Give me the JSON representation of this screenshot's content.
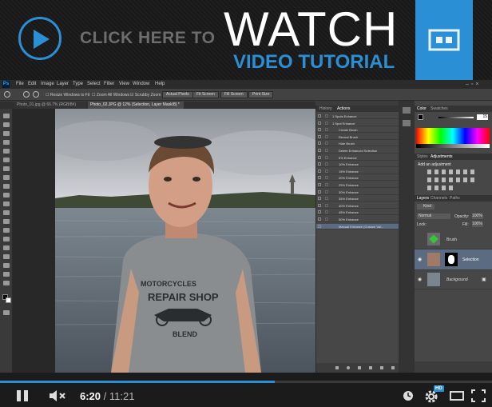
{
  "banner": {
    "cta_text": "CLICK HERE TO",
    "watch_text": "WATCH",
    "subtitle_text": "VIDEO TUTORIAL",
    "accent_color": "#2b8fd6",
    "icon": "play-icon"
  },
  "photoshop": {
    "logo": "Ps",
    "menus": [
      "File",
      "Edit",
      "Image",
      "Layer",
      "Type",
      "Select",
      "Filter",
      "View",
      "Window",
      "Help"
    ],
    "options": {
      "resize_windows": "Resize Windows to Fit",
      "zoom_all": "Zoom All Windows",
      "scrubby_zoom": "Scrubby Zoom",
      "actual_pixels": "Actual Pixels",
      "fit_screen": "Fit Screen",
      "fill_screen": "Fill Screen",
      "print_size": "Print Size"
    },
    "doc_tabs": [
      "Photo_01.jpg @ 66.7% (RGB/8#)",
      "Photo_02.JPG @ 12% (Selection, Layer Mask/8) *"
    ],
    "actions_panel": {
      "tabs": [
        "History",
        "Actions"
      ],
      "rows": [
        "1 Spots Enhance",
        "1 Spot Enhance",
        "Create Brush",
        "Reveal Brush",
        "Hide Brush",
        "Delete Enhanced Selection",
        "5% Enhance",
        "10% Enhance",
        "15% Enhance",
        "20% Enhance",
        "25% Enhance",
        "30% Enhance",
        "35% Enhance",
        "40% Enhance",
        "45% Enhance",
        "50% Enhance",
        "Manual Enhance (Custom Val..."
      ],
      "selected_row": "Manual Enhance (Custom Val..."
    },
    "color_panel": {
      "tabs": [
        "Color",
        "Swatches"
      ],
      "value": "15"
    },
    "adjustments_panel": {
      "tabs": [
        "Styles",
        "Adjustments"
      ],
      "title": "Add an adjustment"
    },
    "layers_panel": {
      "tabs": [
        "Layers",
        "Channels",
        "Paths"
      ],
      "kind_label": "Kind",
      "blend_mode": "Normal",
      "opacity_label": "Opacity:",
      "opacity": "100%",
      "lock_label": "Lock:",
      "fill_label": "Fill:",
      "fill": "100%",
      "layers": [
        "Brush",
        "Selection",
        "Background"
      ]
    },
    "shirt_text": {
      "line1": "MOTORCYCLES",
      "line2": "REPAIR SHOP",
      "line3": "BLEND"
    }
  },
  "player": {
    "current_time": "6:20",
    "separator": " / ",
    "total_time": "11:21",
    "progress": 0.558,
    "hd_label": "HD"
  }
}
